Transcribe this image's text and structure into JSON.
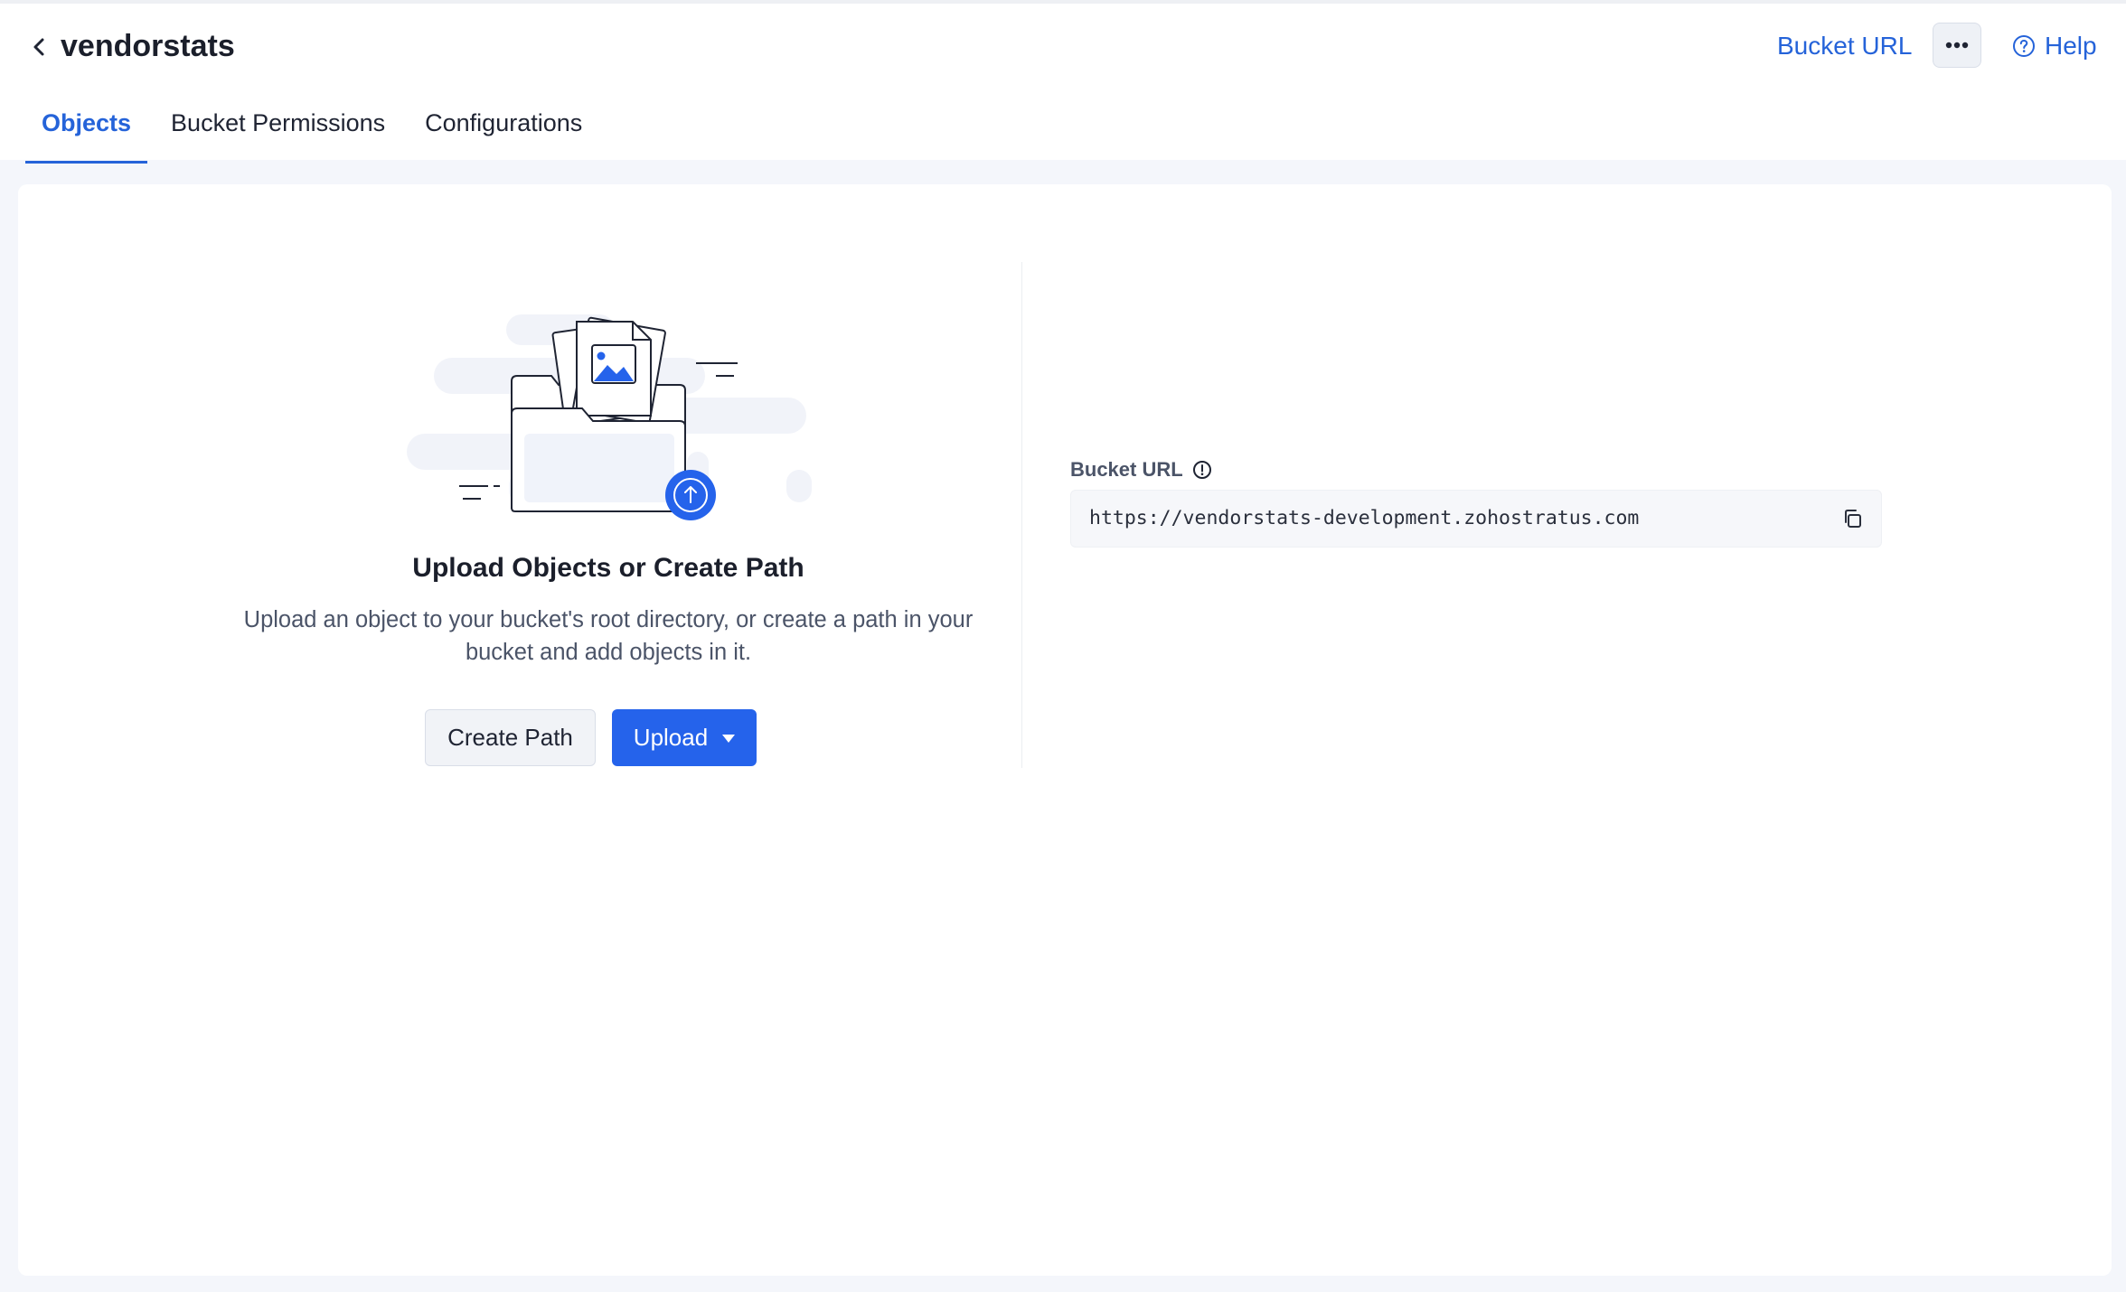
{
  "header": {
    "title": "vendorstats",
    "bucket_url_link": "Bucket URL",
    "help_label": "Help"
  },
  "tabs": [
    {
      "label": "Objects",
      "active": true
    },
    {
      "label": "Bucket Permissions",
      "active": false
    },
    {
      "label": "Configurations",
      "active": false
    }
  ],
  "empty_state": {
    "title": "Upload Objects or Create Path",
    "description": "Upload an object to your bucket's root directory, or create a path in your bucket and add objects in it.",
    "create_path_label": "Create Path",
    "upload_label": "Upload"
  },
  "bucket_url": {
    "label": "Bucket URL",
    "value": "https://vendorstats-development.zohostratus.com"
  },
  "icons": {
    "back": "chevron-left-icon",
    "more": "more-horizontal-icon",
    "help": "help-circle-icon",
    "info": "info-circle-icon",
    "copy": "copy-icon",
    "upload_caret": "caret-down-icon"
  },
  "colors": {
    "accent": "#2563eb",
    "link": "#2563d9",
    "background": "#f4f6fb"
  }
}
